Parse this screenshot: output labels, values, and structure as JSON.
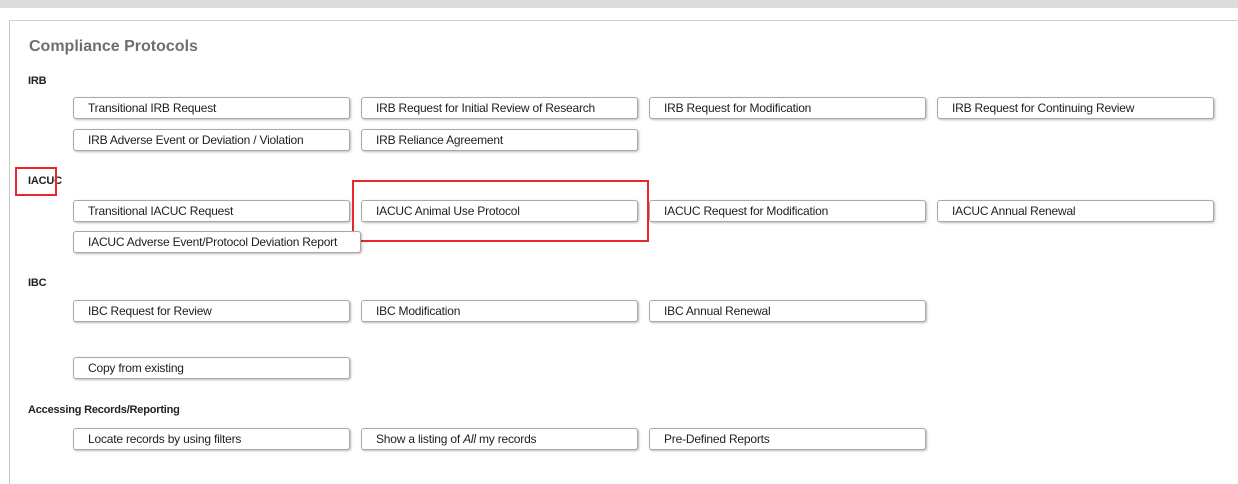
{
  "title": "Compliance Protocols",
  "sections": {
    "irb": {
      "label": "IRB",
      "buttons": [
        "Transitional IRB Request",
        "IRB Request for Initial Review of Research",
        "IRB Request for Modification",
        "IRB Request for Continuing Review",
        "IRB Adverse Event or Deviation / Violation",
        "IRB Reliance Agreement"
      ]
    },
    "iacuc": {
      "label": "IACUC",
      "buttons": [
        "Transitional IACUC Request",
        "IACUC Animal Use Protocol",
        "IACUC Request for Modification",
        "IACUC Annual Renewal",
        "IACUC Adverse Event/Protocol Deviation Report"
      ]
    },
    "ibc": {
      "label": "IBC",
      "buttons": [
        "IBC Request for Review",
        "IBC Modification",
        "IBC Annual Renewal"
      ],
      "copy_label": "Copy from existing"
    },
    "records": {
      "label": "Accessing Records/Reporting",
      "buttons": {
        "locate": "Locate records by using filters",
        "listing_prefix": "Show a listing of ",
        "listing_emphasis": "All",
        "listing_suffix": " my records",
        "reports": "Pre-Defined Reports"
      }
    }
  },
  "colors": {
    "highlight": "#e8262b",
    "title": "#6e6e6e"
  }
}
